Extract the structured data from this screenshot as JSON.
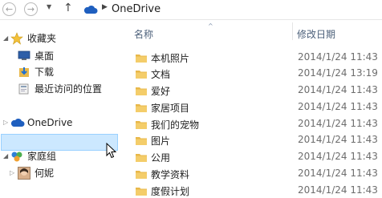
{
  "address": {
    "back_icon": "back-arrow-icon",
    "forward_icon": "forward-arrow-icon",
    "recent_icon": "chevron-down-icon",
    "up_icon": "up-arrow-icon",
    "location_icon": "onedrive-cloud-icon",
    "path": "OneDrive"
  },
  "navigation": {
    "favorites": {
      "label": "收藏夹",
      "icon": "star-icon",
      "items": [
        {
          "label": "桌面",
          "icon": "desktop-icon"
        },
        {
          "label": "下载",
          "icon": "downloads-icon"
        },
        {
          "label": "最近访问的位置",
          "icon": "recent-places-icon"
        }
      ]
    },
    "onedrive": {
      "label": "OneDrive",
      "icon": "onedrive-cloud-icon",
      "selected": true
    },
    "homegroup": {
      "label": "家庭组",
      "icon": "homegroup-icon",
      "items": [
        {
          "label": "何妮",
          "icon": "user-avatar-icon"
        }
      ]
    }
  },
  "columns": {
    "name": "名称",
    "modified": "修改日期"
  },
  "files": [
    {
      "name": "本机照片",
      "modified": "2014/1/24 11:43"
    },
    {
      "name": "文档",
      "modified": "2014/1/24 13:19"
    },
    {
      "name": "爱好",
      "modified": "2014/1/24 11:43"
    },
    {
      "name": "家居项目",
      "modified": "2014/1/24 11:43"
    },
    {
      "name": "我们的宠物",
      "modified": "2014/1/24 11:43"
    },
    {
      "name": "图片",
      "modified": "2014/1/24 11:43"
    },
    {
      "name": "公用",
      "modified": "2014/1/24 11:43"
    },
    {
      "name": "教学资料",
      "modified": "2014/1/24 11:43"
    },
    {
      "name": "度假计划",
      "modified": "2014/1/24 11:43"
    }
  ],
  "colors": {
    "selection": "#cce8ff",
    "selection_border": "#99d1ff",
    "folder": "#e8b84a",
    "cloud": "#1f5fbf"
  }
}
